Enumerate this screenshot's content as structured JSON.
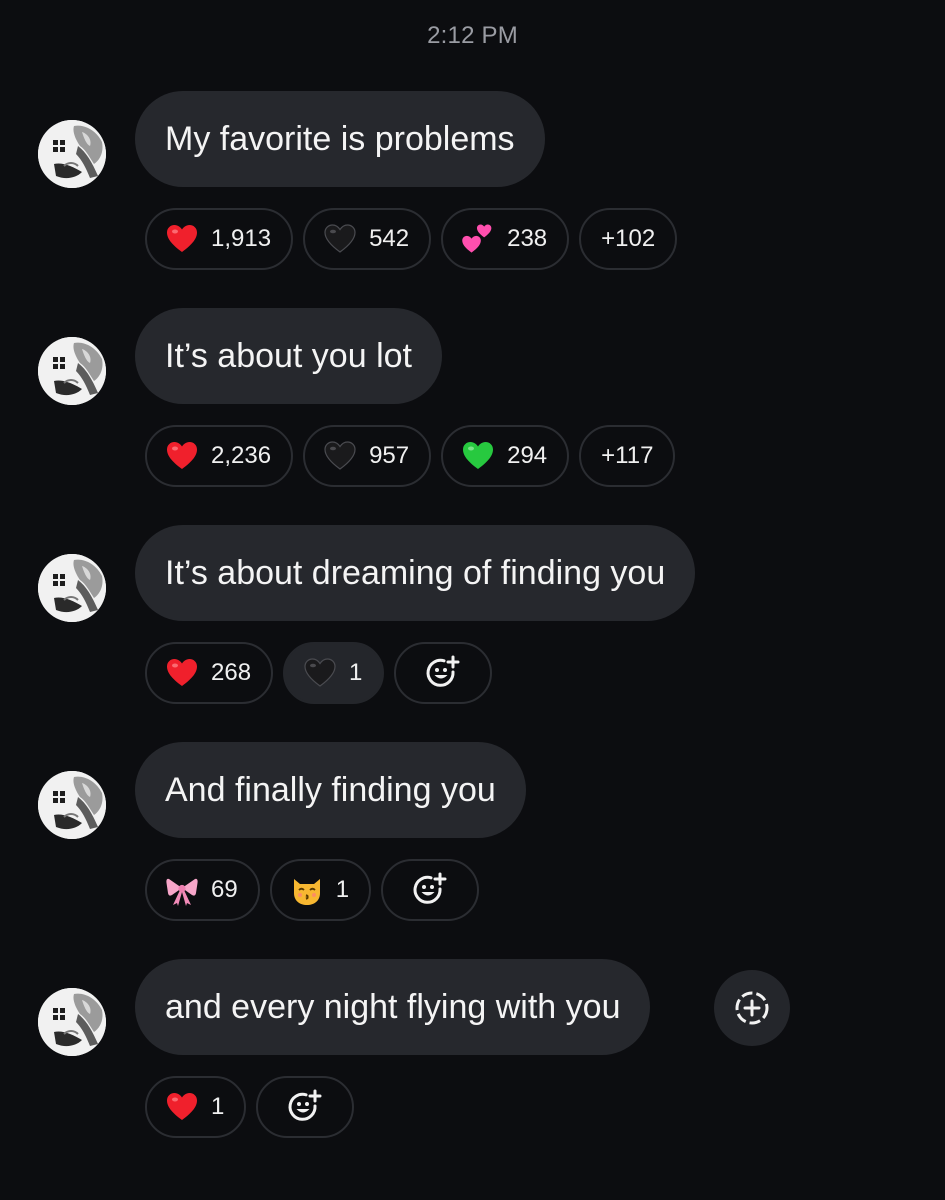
{
  "header": {
    "timestamp": "2:12 PM"
  },
  "messages": [
    {
      "text": "My favorite is problems",
      "reactions": [
        {
          "emoji": "red-heart-icon",
          "count": "1,913"
        },
        {
          "emoji": "black-heart-icon",
          "count": "542"
        },
        {
          "emoji": "two-hearts-icon",
          "count": "238"
        }
      ],
      "more": "+102"
    },
    {
      "text": "It’s about you lot",
      "reactions": [
        {
          "emoji": "red-heart-icon",
          "count": "2,236"
        },
        {
          "emoji": "black-heart-icon",
          "count": "957"
        },
        {
          "emoji": "green-heart-icon",
          "count": "294"
        }
      ],
      "more": "+117"
    },
    {
      "text": "It’s about dreaming of finding you",
      "reactions": [
        {
          "emoji": "red-heart-icon",
          "count": "268"
        },
        {
          "emoji": "black-heart-icon",
          "count": "1",
          "selected": true
        }
      ],
      "add_reaction": true
    },
    {
      "text": "And finally finding you",
      "reactions": [
        {
          "emoji": "ribbon-bow-icon",
          "count": "69"
        },
        {
          "emoji": "kissing-cat-icon",
          "count": "1"
        }
      ],
      "add_reaction": true
    },
    {
      "text": "and every night flying with you",
      "reactions": [
        {
          "emoji": "red-heart-icon",
          "count": "1"
        }
      ],
      "add_reaction": true,
      "side_action": "add-circle-icon"
    }
  ],
  "colors": {
    "background": "#0c0d10",
    "bubble": "#26282d",
    "chip_border": "#2b2d32",
    "timestamp": "#9a9ca3",
    "text": "#f4f4f4"
  }
}
